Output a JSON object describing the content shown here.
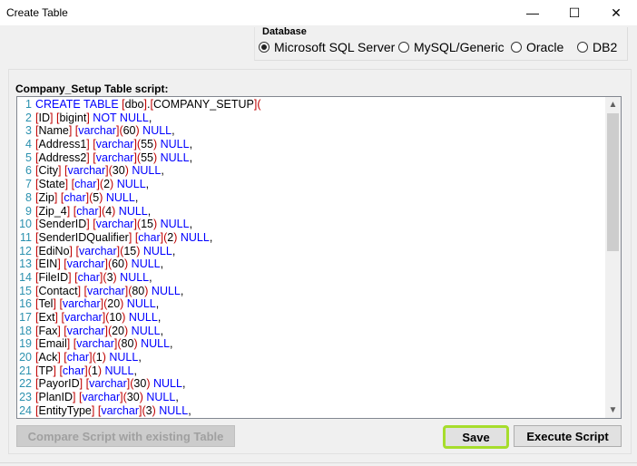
{
  "window": {
    "title": "Create Table",
    "controls": {
      "minimize": "—",
      "maximize": "☐",
      "close": "✕"
    }
  },
  "database": {
    "legend": "Database",
    "options": [
      {
        "label": "Microsoft SQL Server",
        "selected": true
      },
      {
        "label": "MySQL/Generic",
        "selected": false
      },
      {
        "label": "Oracle",
        "selected": false
      },
      {
        "label": "DB2",
        "selected": false
      }
    ]
  },
  "script": {
    "label": "Company_Setup Table script:",
    "lines": [
      {
        "n": "1",
        "parts": [
          [
            "kw",
            "CREATE TABLE "
          ],
          [
            "br",
            "["
          ],
          [
            "tx",
            "dbo"
          ],
          [
            "br",
            "]"
          ],
          [
            "tx",
            "."
          ],
          [
            "br",
            "["
          ],
          [
            "tx",
            "COMPANY_SETUP"
          ],
          [
            "br",
            "]("
          ]
        ]
      },
      {
        "n": "2",
        "parts": [
          [
            "br",
            "["
          ],
          [
            "tx",
            "ID"
          ],
          [
            "br",
            "]"
          ],
          [
            "tx",
            " "
          ],
          [
            "br",
            "["
          ],
          [
            "tx",
            "bigint"
          ],
          [
            "br",
            "]"
          ],
          [
            "kw",
            " NOT NULL"
          ],
          [
            "tx",
            ","
          ]
        ]
      },
      {
        "n": "3",
        "parts": [
          [
            "br",
            "["
          ],
          [
            "tx",
            "Name"
          ],
          [
            "br",
            "]"
          ],
          [
            "tx",
            " "
          ],
          [
            "br",
            "["
          ],
          [
            "kw",
            "varchar"
          ],
          [
            "br",
            "]("
          ],
          [
            "tx",
            "60"
          ],
          [
            "br",
            ")"
          ],
          [
            "kw",
            " NULL"
          ],
          [
            "tx",
            ","
          ]
        ]
      },
      {
        "n": "4",
        "parts": [
          [
            "br",
            "["
          ],
          [
            "tx",
            "Address1"
          ],
          [
            "br",
            "]"
          ],
          [
            "tx",
            " "
          ],
          [
            "br",
            "["
          ],
          [
            "kw",
            "varchar"
          ],
          [
            "br",
            "]("
          ],
          [
            "tx",
            "55"
          ],
          [
            "br",
            ")"
          ],
          [
            "kw",
            " NULL"
          ],
          [
            "tx",
            ","
          ]
        ]
      },
      {
        "n": "5",
        "parts": [
          [
            "br",
            "["
          ],
          [
            "tx",
            "Address2"
          ],
          [
            "br",
            "]"
          ],
          [
            "tx",
            " "
          ],
          [
            "br",
            "["
          ],
          [
            "kw",
            "varchar"
          ],
          [
            "br",
            "]("
          ],
          [
            "tx",
            "55"
          ],
          [
            "br",
            ")"
          ],
          [
            "kw",
            " NULL"
          ],
          [
            "tx",
            ","
          ]
        ]
      },
      {
        "n": "6",
        "parts": [
          [
            "br",
            "["
          ],
          [
            "tx",
            "City"
          ],
          [
            "br",
            "]"
          ],
          [
            "tx",
            " "
          ],
          [
            "br",
            "["
          ],
          [
            "kw",
            "varchar"
          ],
          [
            "br",
            "]("
          ],
          [
            "tx",
            "30"
          ],
          [
            "br",
            ")"
          ],
          [
            "kw",
            " NULL"
          ],
          [
            "tx",
            ","
          ]
        ]
      },
      {
        "n": "7",
        "parts": [
          [
            "br",
            "["
          ],
          [
            "tx",
            "State"
          ],
          [
            "br",
            "]"
          ],
          [
            "tx",
            " "
          ],
          [
            "br",
            "["
          ],
          [
            "kw",
            "char"
          ],
          [
            "br",
            "]("
          ],
          [
            "tx",
            "2"
          ],
          [
            "br",
            ")"
          ],
          [
            "kw",
            " NULL"
          ],
          [
            "tx",
            ","
          ]
        ]
      },
      {
        "n": "8",
        "parts": [
          [
            "br",
            "["
          ],
          [
            "tx",
            "Zip"
          ],
          [
            "br",
            "]"
          ],
          [
            "tx",
            " "
          ],
          [
            "br",
            "["
          ],
          [
            "kw",
            "char"
          ],
          [
            "br",
            "]("
          ],
          [
            "tx",
            "5"
          ],
          [
            "br",
            ")"
          ],
          [
            "kw",
            " NULL"
          ],
          [
            "tx",
            ","
          ]
        ]
      },
      {
        "n": "9",
        "parts": [
          [
            "br",
            "["
          ],
          [
            "tx",
            "Zip_4"
          ],
          [
            "br",
            "]"
          ],
          [
            "tx",
            " "
          ],
          [
            "br",
            "["
          ],
          [
            "kw",
            "char"
          ],
          [
            "br",
            "]("
          ],
          [
            "tx",
            "4"
          ],
          [
            "br",
            ")"
          ],
          [
            "kw",
            " NULL"
          ],
          [
            "tx",
            ","
          ]
        ]
      },
      {
        "n": "10",
        "parts": [
          [
            "br",
            "["
          ],
          [
            "tx",
            "SenderID"
          ],
          [
            "br",
            "]"
          ],
          [
            "tx",
            " "
          ],
          [
            "br",
            "["
          ],
          [
            "kw",
            "varchar"
          ],
          [
            "br",
            "]("
          ],
          [
            "tx",
            "15"
          ],
          [
            "br",
            ")"
          ],
          [
            "kw",
            " NULL"
          ],
          [
            "tx",
            ","
          ]
        ]
      },
      {
        "n": "11",
        "parts": [
          [
            "br",
            "["
          ],
          [
            "tx",
            "SenderIDQualifier"
          ],
          [
            "br",
            "]"
          ],
          [
            "tx",
            " "
          ],
          [
            "br",
            "["
          ],
          [
            "kw",
            "char"
          ],
          [
            "br",
            "]("
          ],
          [
            "tx",
            "2"
          ],
          [
            "br",
            ")"
          ],
          [
            "kw",
            " NULL"
          ],
          [
            "tx",
            ","
          ]
        ]
      },
      {
        "n": "12",
        "parts": [
          [
            "br",
            "["
          ],
          [
            "tx",
            "EdiNo"
          ],
          [
            "br",
            "]"
          ],
          [
            "tx",
            " "
          ],
          [
            "br",
            "["
          ],
          [
            "kw",
            "varchar"
          ],
          [
            "br",
            "]("
          ],
          [
            "tx",
            "15"
          ],
          [
            "br",
            ")"
          ],
          [
            "kw",
            " NULL"
          ],
          [
            "tx",
            ","
          ]
        ]
      },
      {
        "n": "13",
        "parts": [
          [
            "br",
            "["
          ],
          [
            "tx",
            "EIN"
          ],
          [
            "br",
            "]"
          ],
          [
            "tx",
            " "
          ],
          [
            "br",
            "["
          ],
          [
            "kw",
            "varchar"
          ],
          [
            "br",
            "]("
          ],
          [
            "tx",
            "60"
          ],
          [
            "br",
            ")"
          ],
          [
            "kw",
            " NULL"
          ],
          [
            "tx",
            ","
          ]
        ]
      },
      {
        "n": "14",
        "parts": [
          [
            "br",
            "["
          ],
          [
            "tx",
            "FileID"
          ],
          [
            "br",
            "]"
          ],
          [
            "tx",
            " "
          ],
          [
            "br",
            "["
          ],
          [
            "kw",
            "char"
          ],
          [
            "br",
            "]("
          ],
          [
            "tx",
            "3"
          ],
          [
            "br",
            ")"
          ],
          [
            "kw",
            " NULL"
          ],
          [
            "tx",
            ","
          ]
        ]
      },
      {
        "n": "15",
        "parts": [
          [
            "br",
            "["
          ],
          [
            "tx",
            "Contact"
          ],
          [
            "br",
            "]"
          ],
          [
            "tx",
            " "
          ],
          [
            "br",
            "["
          ],
          [
            "kw",
            "varchar"
          ],
          [
            "br",
            "]("
          ],
          [
            "tx",
            "80"
          ],
          [
            "br",
            ")"
          ],
          [
            "kw",
            " NULL"
          ],
          [
            "tx",
            ","
          ]
        ]
      },
      {
        "n": "16",
        "parts": [
          [
            "br",
            "["
          ],
          [
            "tx",
            "Tel"
          ],
          [
            "br",
            "]"
          ],
          [
            "tx",
            " "
          ],
          [
            "br",
            "["
          ],
          [
            "kw",
            "varchar"
          ],
          [
            "br",
            "]("
          ],
          [
            "tx",
            "20"
          ],
          [
            "br",
            ")"
          ],
          [
            "kw",
            " NULL"
          ],
          [
            "tx",
            ","
          ]
        ]
      },
      {
        "n": "17",
        "parts": [
          [
            "br",
            "["
          ],
          [
            "tx",
            "Ext"
          ],
          [
            "br",
            "]"
          ],
          [
            "tx",
            " "
          ],
          [
            "br",
            "["
          ],
          [
            "kw",
            "varchar"
          ],
          [
            "br",
            "]("
          ],
          [
            "tx",
            "10"
          ],
          [
            "br",
            ")"
          ],
          [
            "kw",
            " NULL"
          ],
          [
            "tx",
            ","
          ]
        ]
      },
      {
        "n": "18",
        "parts": [
          [
            "br",
            "["
          ],
          [
            "tx",
            "Fax"
          ],
          [
            "br",
            "]"
          ],
          [
            "tx",
            " "
          ],
          [
            "br",
            "["
          ],
          [
            "kw",
            "varchar"
          ],
          [
            "br",
            "]("
          ],
          [
            "tx",
            "20"
          ],
          [
            "br",
            ")"
          ],
          [
            "kw",
            " NULL"
          ],
          [
            "tx",
            ","
          ]
        ]
      },
      {
        "n": "19",
        "parts": [
          [
            "br",
            "["
          ],
          [
            "tx",
            "Email"
          ],
          [
            "br",
            "]"
          ],
          [
            "tx",
            " "
          ],
          [
            "br",
            "["
          ],
          [
            "kw",
            "varchar"
          ],
          [
            "br",
            "]("
          ],
          [
            "tx",
            "80"
          ],
          [
            "br",
            ")"
          ],
          [
            "kw",
            " NULL"
          ],
          [
            "tx",
            ","
          ]
        ]
      },
      {
        "n": "20",
        "parts": [
          [
            "br",
            "["
          ],
          [
            "tx",
            "Ack"
          ],
          [
            "br",
            "]"
          ],
          [
            "tx",
            " "
          ],
          [
            "br",
            "["
          ],
          [
            "kw",
            "char"
          ],
          [
            "br",
            "]("
          ],
          [
            "tx",
            "1"
          ],
          [
            "br",
            ")"
          ],
          [
            "kw",
            " NULL"
          ],
          [
            "tx",
            ","
          ]
        ]
      },
      {
        "n": "21",
        "parts": [
          [
            "br",
            "["
          ],
          [
            "tx",
            "TP"
          ],
          [
            "br",
            "]"
          ],
          [
            "tx",
            " "
          ],
          [
            "br",
            "["
          ],
          [
            "kw",
            "char"
          ],
          [
            "br",
            "]("
          ],
          [
            "tx",
            "1"
          ],
          [
            "br",
            ")"
          ],
          [
            "kw",
            " NULL"
          ],
          [
            "tx",
            ","
          ]
        ]
      },
      {
        "n": "22",
        "parts": [
          [
            "br",
            "["
          ],
          [
            "tx",
            "PayorID"
          ],
          [
            "br",
            "]"
          ],
          [
            "tx",
            " "
          ],
          [
            "br",
            "["
          ],
          [
            "kw",
            "varchar"
          ],
          [
            "br",
            "]("
          ],
          [
            "tx",
            "30"
          ],
          [
            "br",
            ")"
          ],
          [
            "kw",
            " NULL"
          ],
          [
            "tx",
            ","
          ]
        ]
      },
      {
        "n": "23",
        "parts": [
          [
            "br",
            "["
          ],
          [
            "tx",
            "PlanID"
          ],
          [
            "br",
            "]"
          ],
          [
            "tx",
            " "
          ],
          [
            "br",
            "["
          ],
          [
            "kw",
            "varchar"
          ],
          [
            "br",
            "]("
          ],
          [
            "tx",
            "30"
          ],
          [
            "br",
            ")"
          ],
          [
            "kw",
            " NULL"
          ],
          [
            "tx",
            ","
          ]
        ]
      },
      {
        "n": "24",
        "parts": [
          [
            "br",
            "["
          ],
          [
            "tx",
            "EntityType"
          ],
          [
            "br",
            "]"
          ],
          [
            "tx",
            " "
          ],
          [
            "br",
            "["
          ],
          [
            "kw",
            "varchar"
          ],
          [
            "br",
            "]("
          ],
          [
            "tx",
            "3"
          ],
          [
            "br",
            ")"
          ],
          [
            "kw",
            " NULL"
          ],
          [
            "tx",
            ","
          ]
        ]
      }
    ]
  },
  "buttons": {
    "compare": "Compare Script with existing Table",
    "save": "Save",
    "execute": "Execute Script"
  },
  "colors": {
    "keyword": "#0000ff",
    "bracket": "#c00000",
    "line_number": "#2b91af",
    "save_highlight": "#a6dd2c"
  }
}
